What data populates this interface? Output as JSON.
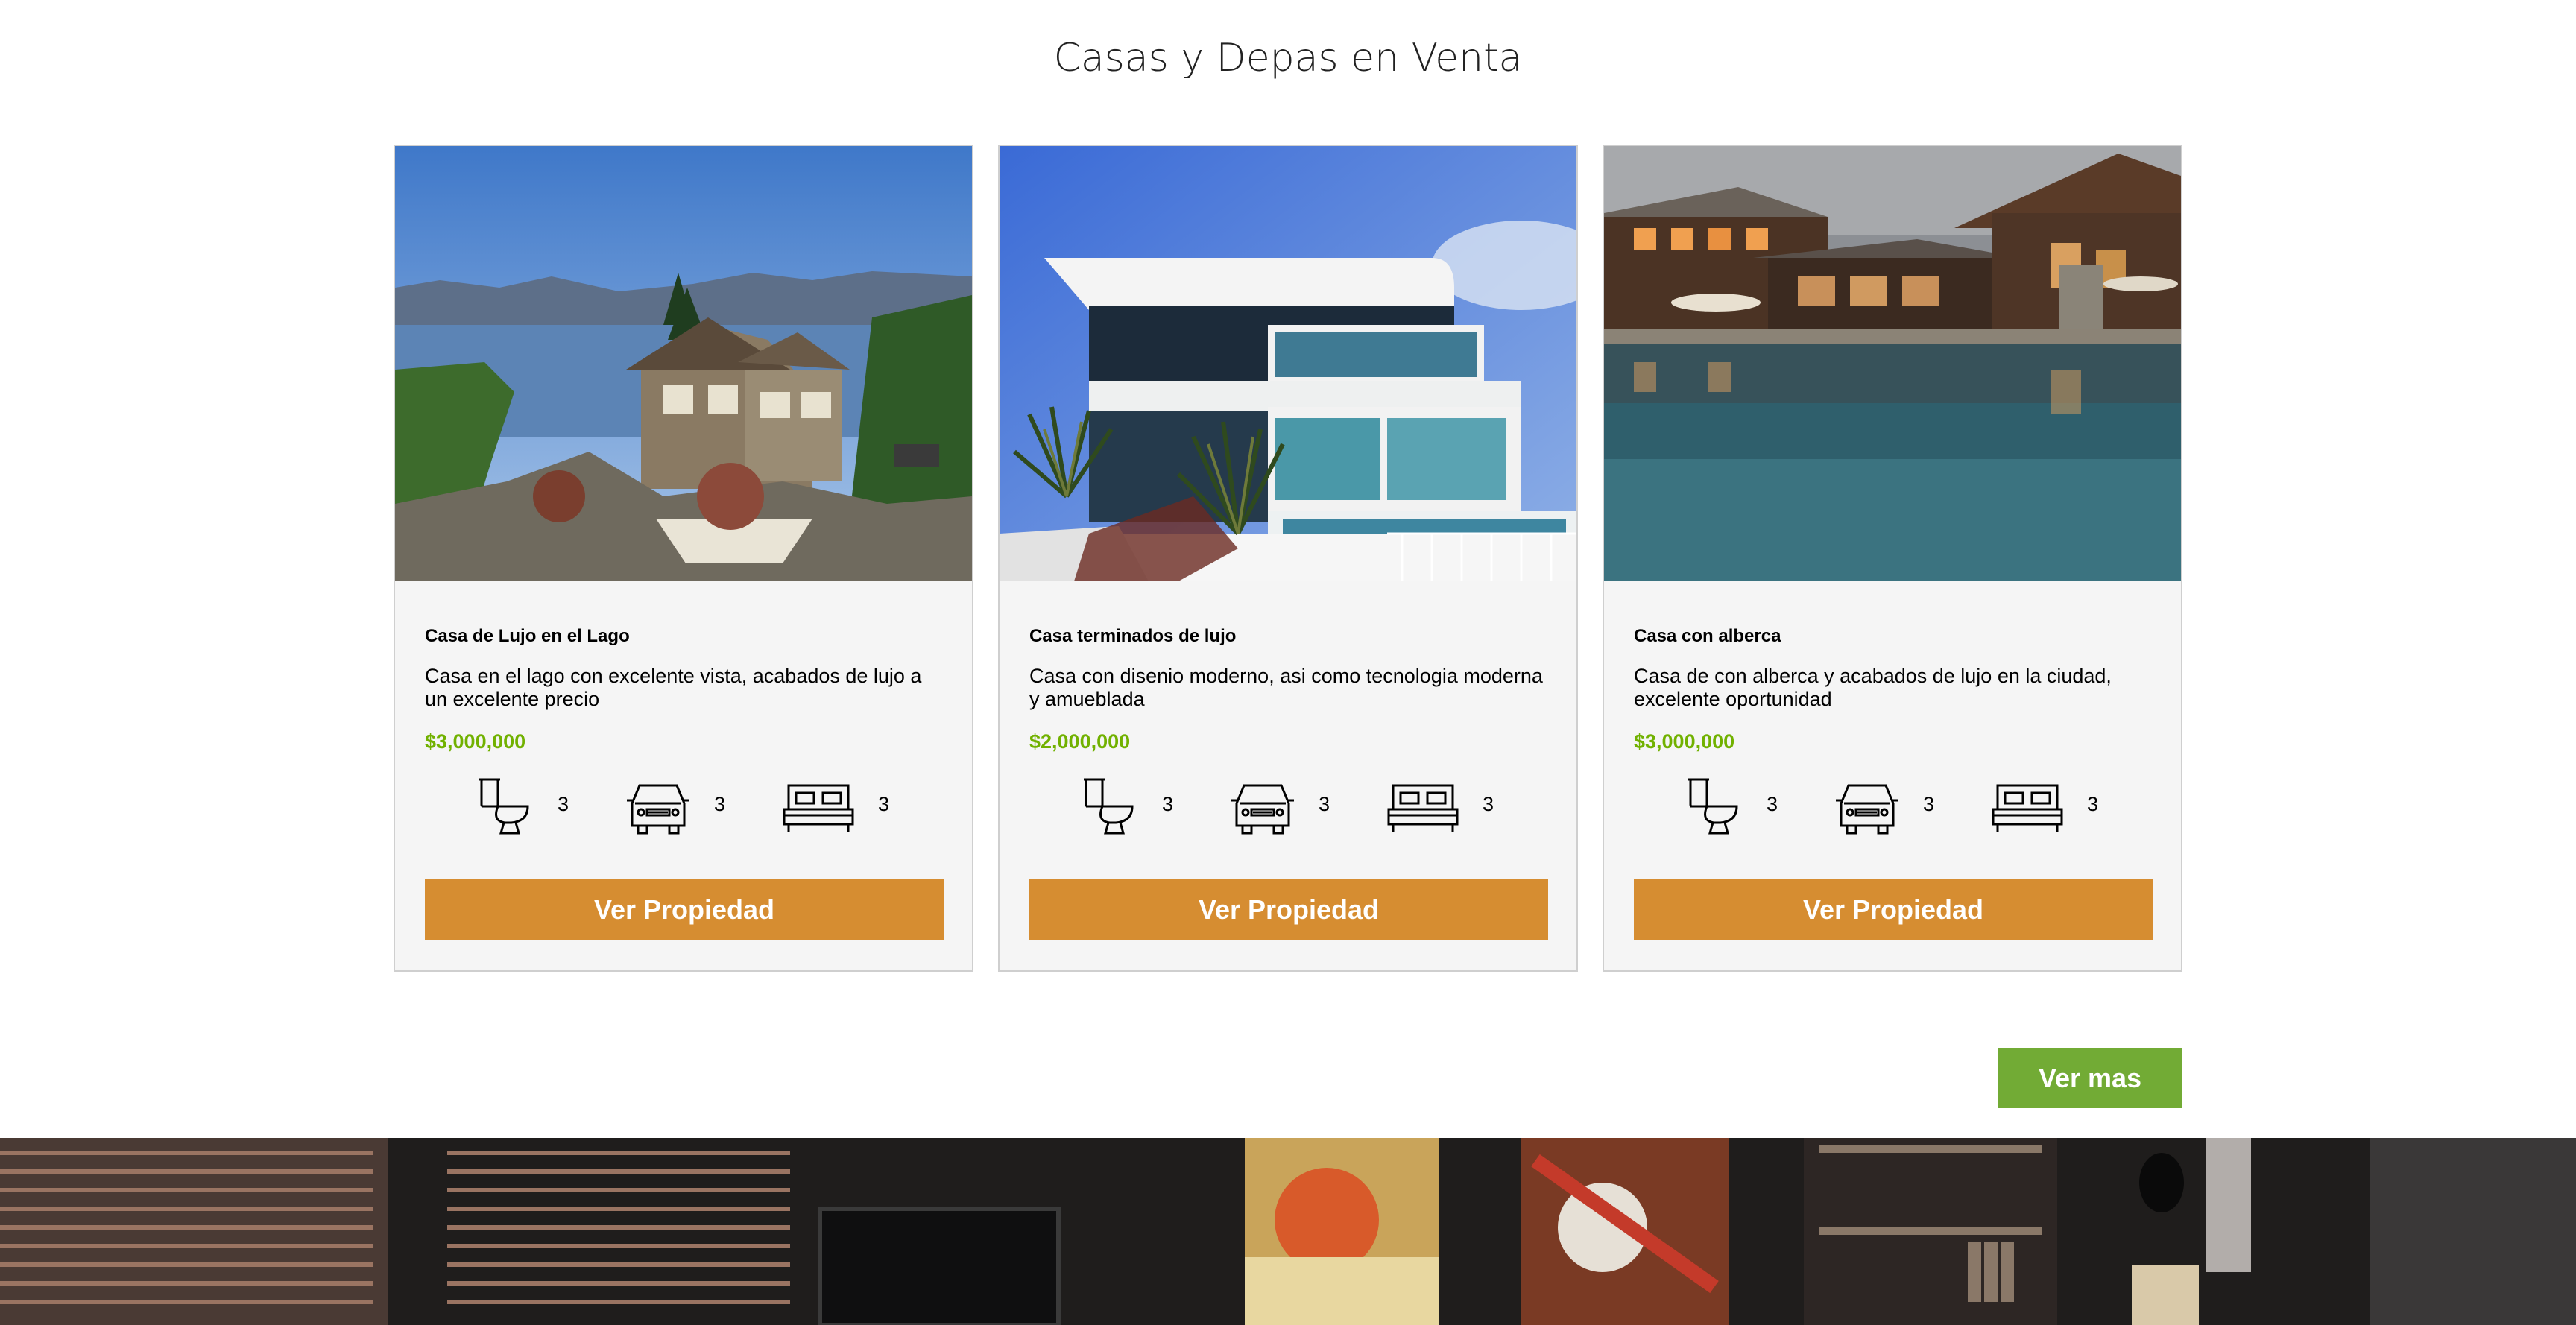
{
  "section": {
    "title": "Casas y Depas en Venta"
  },
  "listings": [
    {
      "title": "Casa de Lujo en el Lago",
      "description": "Casa en el lago con excelente vista, acabados de lujo a un excelente precio",
      "price": "$3,000,000",
      "bathrooms": "3",
      "parking": "3",
      "bedrooms": "3",
      "button_label": "Ver Propiedad",
      "icons": [
        "toilet-icon",
        "car-icon",
        "bed-icon"
      ]
    },
    {
      "title": "Casa terminados de lujo",
      "description": "Casa con disenio moderno, asi como tecnologia moderna y amueblada",
      "price": "$2,000,000",
      "bathrooms": "3",
      "parking": "3",
      "bedrooms": "3",
      "button_label": "Ver Propiedad",
      "icons": [
        "toilet-icon",
        "car-icon",
        "bed-icon"
      ]
    },
    {
      "title": "Casa con alberca",
      "description": "Casa de con alberca y acabados de lujo en la ciudad, excelente oportunidad",
      "price": "$3,000,000",
      "bathrooms": "3",
      "parking": "3",
      "bedrooms": "3",
      "button_label": "Ver Propiedad",
      "icons": [
        "toilet-icon",
        "car-icon",
        "bed-icon"
      ]
    }
  ],
  "more_button": {
    "label": "Ver mas"
  },
  "colors": {
    "price": "#71b100",
    "view_button": "#d68d31",
    "more_button": "#72ab35",
    "card_background": "#f5f5f5"
  }
}
